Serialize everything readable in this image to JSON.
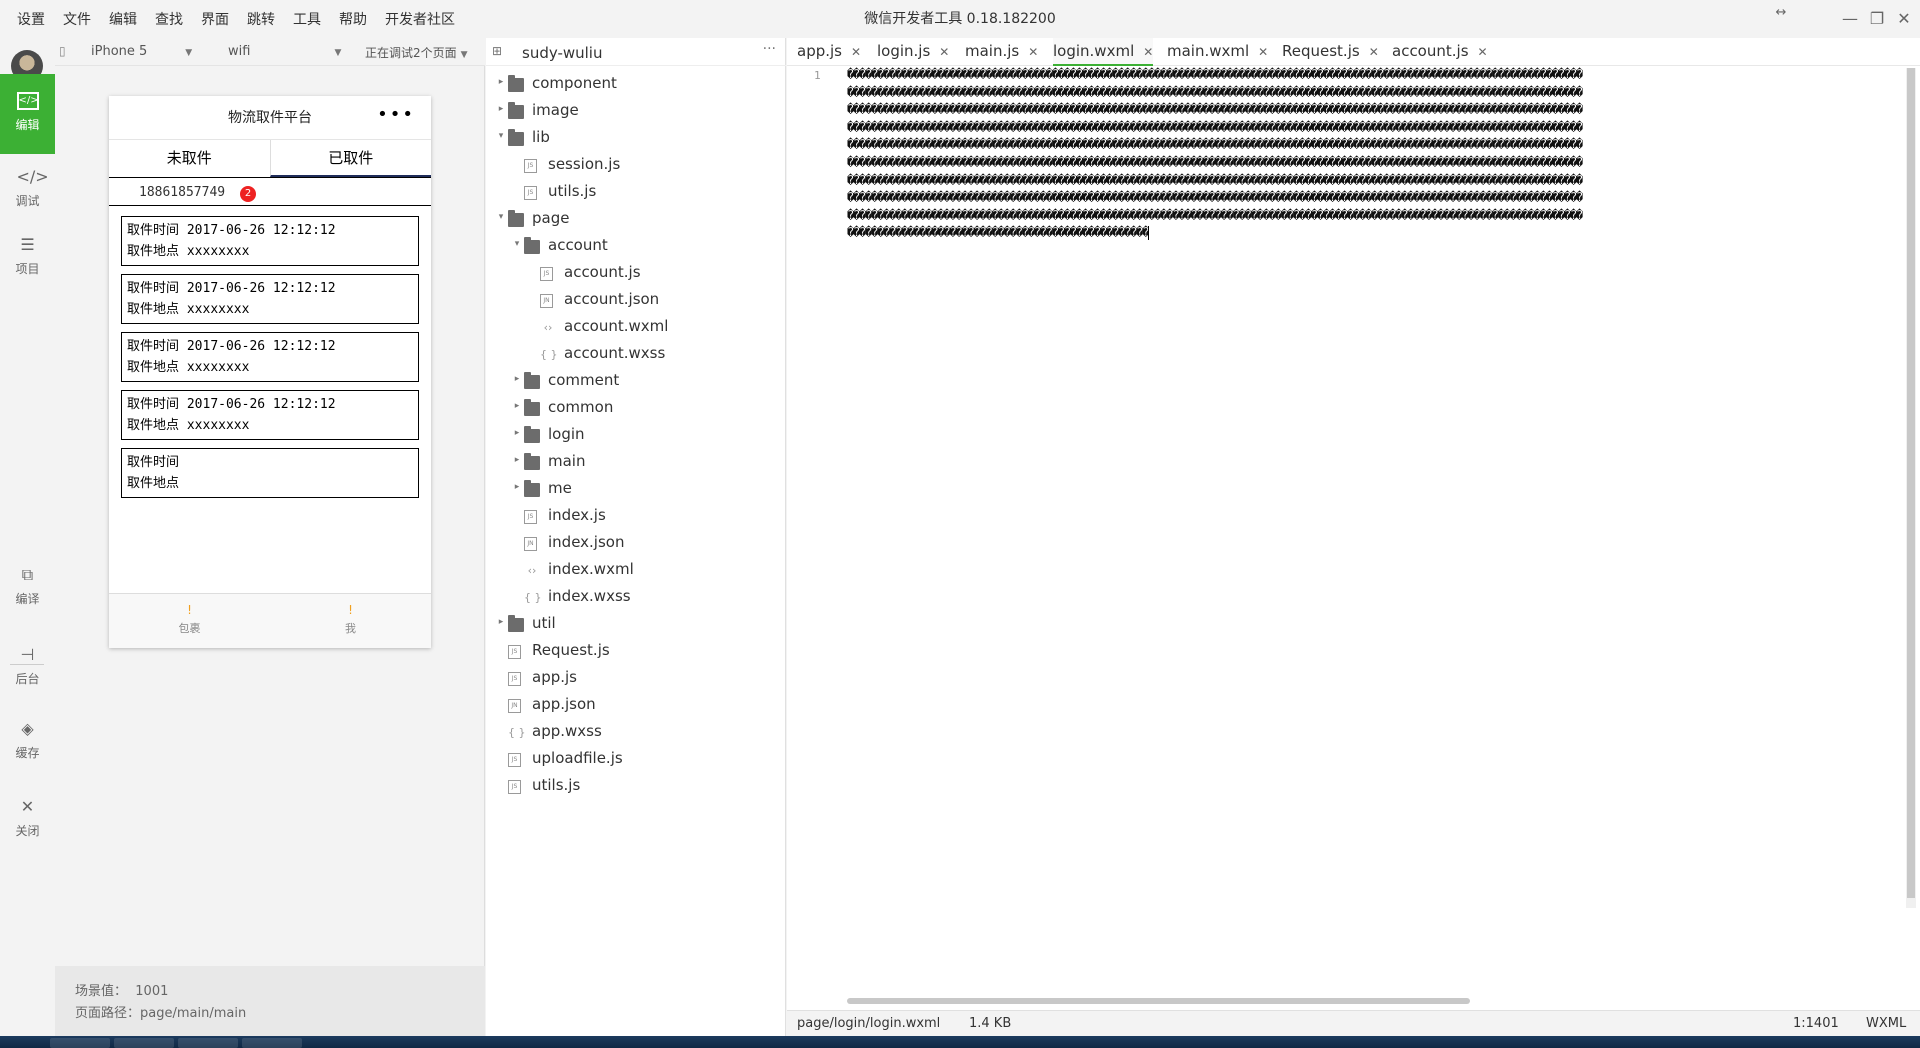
{
  "window": {
    "title": "微信开发者工具 0.18.182200",
    "menu": [
      "设置",
      "文件",
      "编辑",
      "查找",
      "界面",
      "跳转",
      "工具",
      "帮助",
      "开发者社区"
    ]
  },
  "activity_bar": {
    "items": [
      {
        "label": "编辑",
        "icon": "code-box-icon",
        "active": true
      },
      {
        "label": "调试",
        "icon": "code-brackets-icon"
      },
      {
        "label": "项目",
        "icon": "list-icon"
      },
      {
        "label": "编译",
        "icon": "compile-icon"
      },
      {
        "label": "后台",
        "icon": "backend-icon"
      },
      {
        "label": "缓存",
        "icon": "layers-icon"
      },
      {
        "label": "关闭",
        "icon": "close-icon"
      }
    ]
  },
  "simulator": {
    "device": "iPhone 5",
    "network": "wifi",
    "debug_status": "正在调试2个页面",
    "app": {
      "nav_title": "物流取件平台",
      "nav_more": "•••",
      "tabs": [
        "未取件",
        "已取件"
      ],
      "selected_tab": 1,
      "phone": "18861857749",
      "badge": "2",
      "records": [
        {
          "time_label": "取件时间",
          "time": "2017-06-26 12:12:12",
          "place_label": "取件地点",
          "place": "xxxxxxxx"
        },
        {
          "time_label": "取件时间",
          "time": "2017-06-26 12:12:12",
          "place_label": "取件地点",
          "place": "xxxxxxxx"
        },
        {
          "time_label": "取件时间",
          "time": "2017-06-26 12:12:12",
          "place_label": "取件地点",
          "place": "xxxxxxxx"
        },
        {
          "time_label": "取件时间",
          "time": "2017-06-26 12:12:12",
          "place_label": "取件地点",
          "place": "xxxxxxxx"
        },
        {
          "time_label": "取件时间",
          "time": "",
          "place_label": "取件地点",
          "place": ""
        }
      ],
      "tabbar": [
        "包裹",
        "我"
      ]
    },
    "footer": {
      "scene_label": "场景值：",
      "scene_value": "1001",
      "path_label": "页面路径：",
      "path_value": "page/main/main"
    }
  },
  "explorer": {
    "project": "sudy-wuliu",
    "more": "···",
    "tree": [
      {
        "name": "component",
        "type": "folder",
        "depth": 0,
        "open": false
      },
      {
        "name": "image",
        "type": "folder",
        "depth": 0,
        "open": false
      },
      {
        "name": "lib",
        "type": "folder",
        "depth": 0,
        "open": true
      },
      {
        "name": "session.js",
        "type": "js",
        "depth": 1
      },
      {
        "name": "utils.js",
        "type": "js",
        "depth": 1
      },
      {
        "name": "page",
        "type": "folder",
        "depth": 0,
        "open": true
      },
      {
        "name": "account",
        "type": "folder",
        "depth": 1,
        "open": true
      },
      {
        "name": "account.js",
        "type": "js",
        "depth": 2
      },
      {
        "name": "account.json",
        "type": "json",
        "depth": 2
      },
      {
        "name": "account.wxml",
        "type": "wxml",
        "depth": 2
      },
      {
        "name": "account.wxss",
        "type": "wxss",
        "depth": 2
      },
      {
        "name": "comment",
        "type": "folder",
        "depth": 1,
        "open": false
      },
      {
        "name": "common",
        "type": "folder",
        "depth": 1,
        "open": false
      },
      {
        "name": "login",
        "type": "folder",
        "depth": 1,
        "open": false
      },
      {
        "name": "main",
        "type": "folder",
        "depth": 1,
        "open": false
      },
      {
        "name": "me",
        "type": "folder",
        "depth": 1,
        "open": false
      },
      {
        "name": "index.js",
        "type": "js",
        "depth": 1
      },
      {
        "name": "index.json",
        "type": "json",
        "depth": 1
      },
      {
        "name": "index.wxml",
        "type": "wxml",
        "depth": 1
      },
      {
        "name": "index.wxss",
        "type": "wxss",
        "depth": 1
      },
      {
        "name": "util",
        "type": "folder",
        "depth": 0,
        "open": false
      },
      {
        "name": "Request.js",
        "type": "js",
        "depth": 0
      },
      {
        "name": "app.js",
        "type": "js",
        "depth": 0
      },
      {
        "name": "app.json",
        "type": "json",
        "depth": 0
      },
      {
        "name": "app.wxss",
        "type": "wxss",
        "depth": 0
      },
      {
        "name": "uploadfile.js",
        "type": "js",
        "depth": 0
      },
      {
        "name": "utils.js",
        "type": "js",
        "depth": 0
      }
    ]
  },
  "editor": {
    "tabs": [
      "app.js",
      "login.js",
      "main.js",
      "login.wxml",
      "main.wxml",
      "Request.js",
      "account.js"
    ],
    "active_tab": 3,
    "line_number": "1",
    "code_lines": [
      "��������������������������������������������������������������������������������������������������������������������������",
      "��������������������������������������������������������������������������������������������������������������������������",
      "��������������������������������������������������������������������������������������������������������������������������",
      "��������������������������������������������������������������������������������������������������������������������������",
      "��������������������������������������������������������������������������������������������������������������������������",
      "��������������������������������������������������������������������������������������������������������������������������",
      "��������������������������������������������������������������������������������������������������������������������������",
      "��������������������������������������������������������������������������������������������������������������������������",
      "��������������������������������������������������������������������������������������������������������������������������",
      "��������������������������������������������������"
    ]
  },
  "status_bar": {
    "path": "page/login/login.wxml",
    "size": "1.4 KB",
    "position": "1:1401",
    "language": "WXML"
  }
}
